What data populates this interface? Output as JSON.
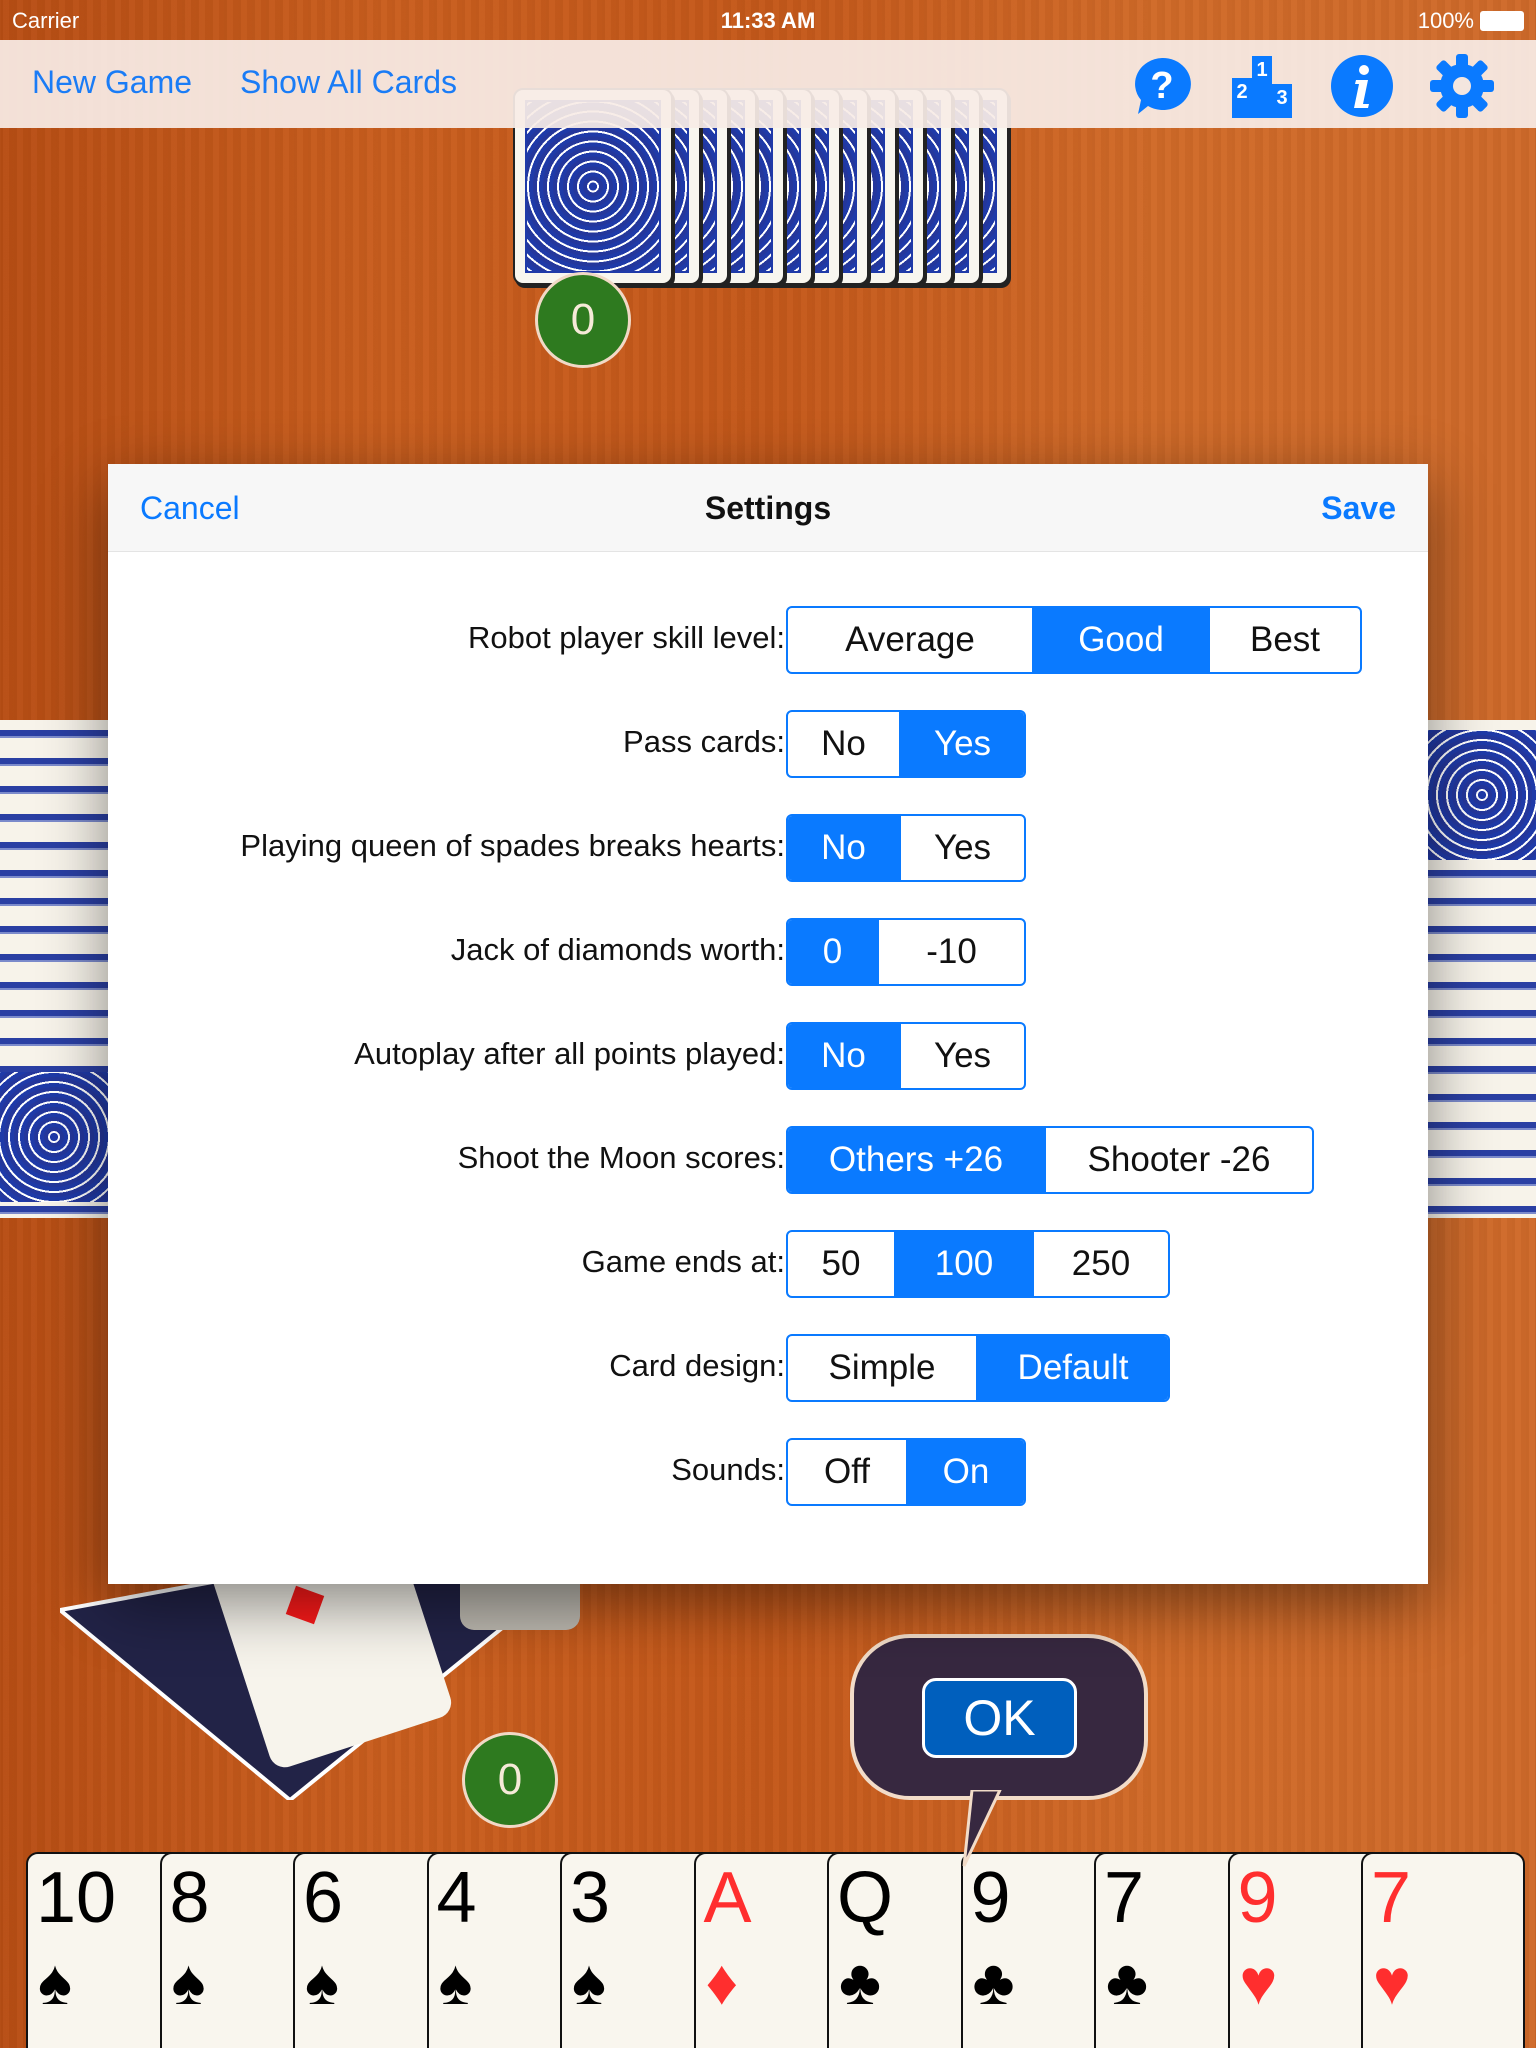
{
  "status_bar": {
    "carrier": "Carrier",
    "time": "11:33 AM",
    "battery": "100%"
  },
  "navbar": {
    "new_game": "New Game",
    "show_all_cards": "Show All Cards",
    "icons": [
      "help-icon",
      "leaderboard-icon",
      "info-icon",
      "gear-icon"
    ],
    "podium": [
      "2",
      "1",
      "3"
    ]
  },
  "table": {
    "top_player_score": "0",
    "bottom_player_score": "0",
    "ok_label": "OK"
  },
  "settings": {
    "title": "Settings",
    "cancel": "Cancel",
    "save": "Save",
    "rows": [
      {
        "label": "Robot player skill level:",
        "options": [
          "Average",
          "Good",
          "Best"
        ],
        "selected": 1
      },
      {
        "label": "Pass cards:",
        "options": [
          "No",
          "Yes"
        ],
        "selected": 1
      },
      {
        "label": "Playing queen of spades breaks hearts:",
        "options": [
          "No",
          "Yes"
        ],
        "selected": 0
      },
      {
        "label": "Jack of diamonds worth:",
        "options": [
          "0",
          "-10"
        ],
        "selected": 0
      },
      {
        "label": "Autoplay after all points played:",
        "options": [
          "No",
          "Yes"
        ],
        "selected": 0
      },
      {
        "label": "Shoot the Moon scores:",
        "options": [
          "Others +26",
          "Shooter -26"
        ],
        "selected": 0
      },
      {
        "label": "Game ends at:",
        "options": [
          "50",
          "100",
          "250"
        ],
        "selected": 1
      },
      {
        "label": "Card design:",
        "options": [
          "Simple",
          "Default"
        ],
        "selected": 1
      },
      {
        "label": "Sounds:",
        "options": [
          "Off",
          "On"
        ],
        "selected": 1
      }
    ]
  },
  "hand": [
    {
      "rank": "10",
      "suit": "♠",
      "color": "black"
    },
    {
      "rank": "8",
      "suit": "♠",
      "color": "black"
    },
    {
      "rank": "6",
      "suit": "♠",
      "color": "black"
    },
    {
      "rank": "4",
      "suit": "♠",
      "color": "black"
    },
    {
      "rank": "3",
      "suit": "♠",
      "color": "black"
    },
    {
      "rank": "A",
      "suit": "♦",
      "color": "red"
    },
    {
      "rank": "Q",
      "suit": "♣",
      "color": "black"
    },
    {
      "rank": "9",
      "suit": "♣",
      "color": "black"
    },
    {
      "rank": "7",
      "suit": "♣",
      "color": "black"
    },
    {
      "rank": "9",
      "suit": "♥",
      "color": "red"
    },
    {
      "rank": "7",
      "suit": "♥",
      "color": "red"
    }
  ],
  "colors": {
    "accent": "#0a7aff",
    "chip": "#2e7a1f",
    "bubble": "#372840",
    "ok_button": "#005fbd"
  }
}
